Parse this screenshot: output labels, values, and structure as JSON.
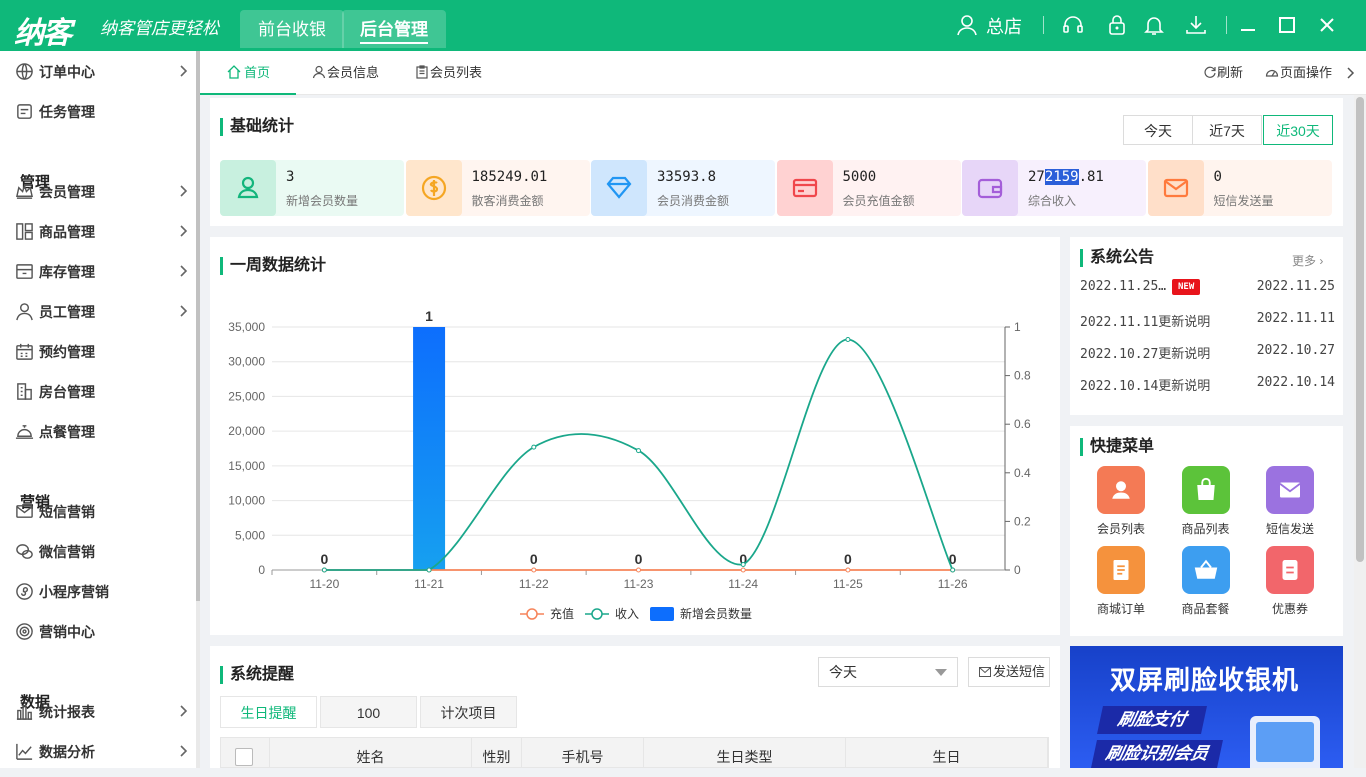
{
  "app": {
    "logo": "纳客",
    "slogan": "纳客管店更轻松",
    "top_tabs": [
      "前台收银",
      "后台管理"
    ],
    "store": "总店"
  },
  "sidebar": {
    "items": [
      {
        "label": "订单中心",
        "icon": "globe-icon",
        "arrow": true
      },
      {
        "label": "任务管理",
        "icon": "task-icon",
        "arrow": false
      },
      {
        "group": "管理"
      },
      {
        "label": "会员管理",
        "icon": "crown-icon",
        "arrow": true
      },
      {
        "label": "商品管理",
        "icon": "goods-icon",
        "arrow": true
      },
      {
        "label": "库存管理",
        "icon": "inventory-icon",
        "arrow": true
      },
      {
        "label": "员工管理",
        "icon": "staff-icon",
        "arrow": true
      },
      {
        "label": "预约管理",
        "icon": "calendar-icon",
        "arrow": false
      },
      {
        "label": "房台管理",
        "icon": "room-icon",
        "arrow": false
      },
      {
        "label": "点餐管理",
        "icon": "bell-dish-icon",
        "arrow": false
      },
      {
        "group": "营销"
      },
      {
        "label": "短信营销",
        "icon": "mail-icon",
        "arrow": false
      },
      {
        "label": "微信营销",
        "icon": "wechat-icon",
        "arrow": false
      },
      {
        "label": "小程序营销",
        "icon": "miniprogram-icon",
        "arrow": false
      },
      {
        "label": "营销中心",
        "icon": "target-icon",
        "arrow": false
      },
      {
        "group": "数据"
      },
      {
        "label": "统计报表",
        "icon": "bar-chart-icon",
        "arrow": true
      },
      {
        "label": "数据分析",
        "icon": "analysis-icon",
        "arrow": true
      }
    ]
  },
  "page_tabs": {
    "home": "首页",
    "member_info": "会员信息",
    "member_list": "会员列表",
    "refresh": "刷新",
    "page_ops": "页面操作"
  },
  "basic_stats": {
    "title": "基础统计",
    "ranges": [
      "今天",
      "近7天",
      "近30天"
    ],
    "active_range": "近30天",
    "cards": [
      {
        "value": "3",
        "label": "新增会员数量",
        "icon": "user-icon",
        "bg": "#eafaf3",
        "ibg": "#c8f0df",
        "color": "#13b57c"
      },
      {
        "value": "185249.01",
        "label": "散客消费金额",
        "icon": "coin-icon",
        "bg": "#fff5f0",
        "ibg": "#ffe6cc",
        "color": "#f5a623"
      },
      {
        "value": "33593.8",
        "label": "会员消费金额",
        "icon": "diamond-icon",
        "bg": "#eef6ff",
        "ibg": "#cfe6fd",
        "color": "#2196f3"
      },
      {
        "value": "5000",
        "label": "会员充值金额",
        "icon": "card-icon",
        "bg": "#fff2f2",
        "ibg": "#ffd2d2",
        "color": "#f0474c"
      },
      {
        "value_pre": "27",
        "value_hl": "2159",
        "value_post": ".81",
        "label": "综合收入",
        "icon": "wallet-icon",
        "bg": "#f7f0fd",
        "ibg": "#e7d6f8",
        "color": "#a45ed9"
      },
      {
        "value": "0",
        "label": "短信发送量",
        "icon": "envelope-icon",
        "bg": "#fff4ee",
        "ibg": "#ffdfc9",
        "color": "#ff7a3d"
      }
    ]
  },
  "weekly": {
    "title": "一周数据统计"
  },
  "chart_data": {
    "type": "bar",
    "categories": [
      "11-20",
      "11-21",
      "11-22",
      "11-23",
      "11-24",
      "11-25",
      "11-26"
    ],
    "series": [
      {
        "name": "充值",
        "type": "line",
        "axis": "left",
        "color": "#f6845a",
        "values": [
          0,
          0,
          0,
          0,
          0,
          0,
          0
        ]
      },
      {
        "name": "收入",
        "type": "line",
        "axis": "left",
        "color": "#1aa78b",
        "values": [
          0,
          0,
          17700,
          17200,
          800,
          33200,
          0
        ]
      },
      {
        "name": "新增会员数量",
        "type": "bar",
        "axis": "right",
        "color": "#0d6efd",
        "values": [
          0,
          1,
          0,
          0,
          0,
          0,
          0
        ]
      }
    ],
    "bar_labels": [
      "0",
      "1",
      "0",
      "0",
      "0",
      "0",
      "0"
    ],
    "y_left": {
      "min": 0,
      "max": 35000,
      "ticks": [
        "0",
        "5,000",
        "10,000",
        "15,000",
        "20,000",
        "25,000",
        "30,000",
        "35,000"
      ]
    },
    "y_right": {
      "min": 0,
      "max": 1,
      "ticks": [
        "0",
        "0.2",
        "0.4",
        "0.6",
        "0.8",
        "1"
      ]
    },
    "legend": "bottom-center",
    "grid": true
  },
  "announce": {
    "title": "系统公告",
    "more": "更多",
    "rows": [
      {
        "text": "2022.11.25…",
        "badge": "NEW",
        "date": "2022.11.25"
      },
      {
        "text": "2022.11.11更新说明",
        "date": "2022.11.11"
      },
      {
        "text": "2022.10.27更新说明",
        "date": "2022.10.27"
      },
      {
        "text": "2022.10.14更新说明",
        "date": "2022.10.14"
      }
    ]
  },
  "quick": {
    "title": "快捷菜单",
    "items": [
      {
        "label": "会员列表",
        "icon": "member-list-icon",
        "color": "#f47a55"
      },
      {
        "label": "商品列表",
        "icon": "shopping-bag-icon",
        "color": "#5cc33a"
      },
      {
        "label": "短信发送",
        "icon": "sms-icon",
        "color": "#9b72e0"
      },
      {
        "label": "商城订单",
        "icon": "order-icon",
        "color": "#f5923d"
      },
      {
        "label": "商品套餐",
        "icon": "basket-icon",
        "color": "#3d9ef0"
      },
      {
        "label": "优惠券",
        "icon": "coupon-icon",
        "color": "#f2666b"
      }
    ]
  },
  "ad": {
    "title": "双屏刷脸收银机",
    "line1": "刷脸支付",
    "line2": "刷脸识别会员"
  },
  "reminder": {
    "title": "系统提醒",
    "select": "今天",
    "send": "发送短信",
    "tabs": [
      "生日提醒",
      "100",
      "计次项目"
    ],
    "columns": [
      "姓名",
      "性别",
      "手机号",
      "生日类型",
      "生日"
    ]
  }
}
